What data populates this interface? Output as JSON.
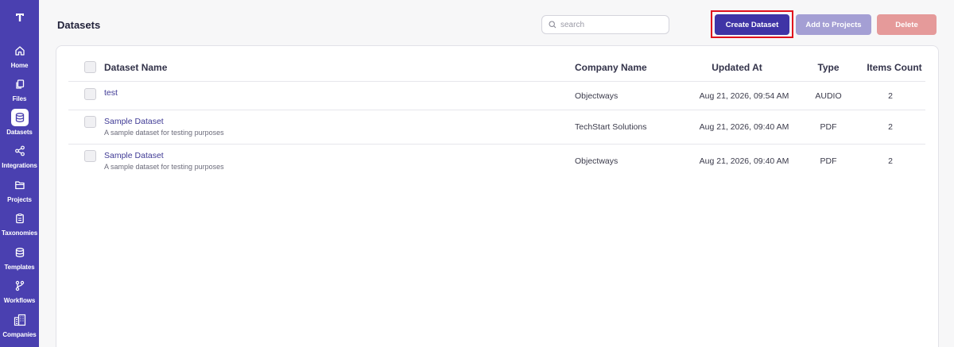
{
  "sidebar": {
    "items": [
      {
        "label": "Home",
        "icon": "home-icon"
      },
      {
        "label": "Files",
        "icon": "files-icon"
      },
      {
        "label": "Datasets",
        "icon": "database-icon",
        "active": true
      },
      {
        "label": "Integrations",
        "icon": "share-icon"
      },
      {
        "label": "Projects",
        "icon": "folder-icon"
      },
      {
        "label": "Taxonomies",
        "icon": "clipboard-icon"
      },
      {
        "label": "Templates",
        "icon": "database-icon"
      },
      {
        "label": "Workflows",
        "icon": "branch-icon"
      },
      {
        "label": "Companies",
        "icon": "building-icon"
      }
    ]
  },
  "header": {
    "title": "Datasets",
    "search_placeholder": "search",
    "create_label": "Create Dataset",
    "add_label": "Add to Projects",
    "delete_label": "Delete"
  },
  "table": {
    "columns": {
      "name": "Dataset Name",
      "company": "Company Name",
      "updated": "Updated At",
      "type": "Type",
      "count": "Items Count"
    },
    "rows": [
      {
        "name": "test",
        "description": "",
        "company": "Objectways",
        "updated": "Aug 21, 2026, 09:54 AM",
        "type": "AUDIO",
        "count": "2"
      },
      {
        "name": "Sample Dataset",
        "description": "A sample dataset for testing purposes",
        "company": "TechStart Solutions",
        "updated": "Aug 21, 2026, 09:40 AM",
        "type": "PDF",
        "count": "2"
      },
      {
        "name": "Sample Dataset",
        "description": "A sample dataset for testing purposes",
        "company": "Objectways",
        "updated": "Aug 21, 2026, 09:40 AM",
        "type": "PDF",
        "count": "2"
      }
    ]
  },
  "colors": {
    "sidebar": "#4a40b0",
    "primary": "#3f34a6",
    "secondary_disabled": "#a49fd4",
    "danger_disabled": "#e59a9a",
    "highlight": "#e0101d"
  }
}
